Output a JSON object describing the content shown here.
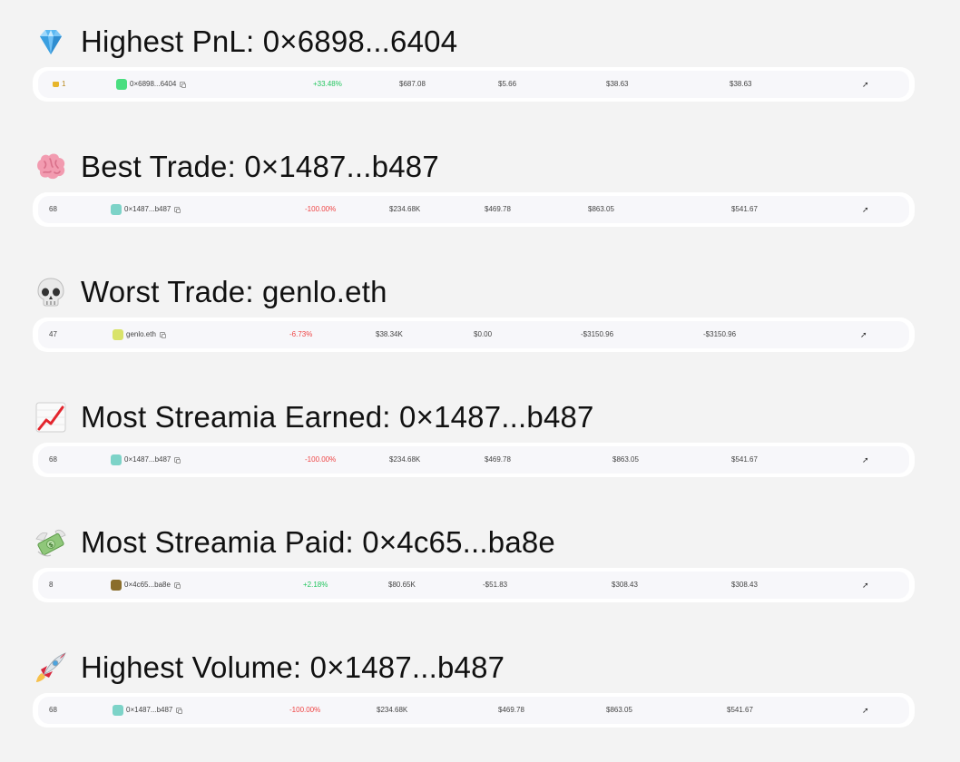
{
  "sections": [
    {
      "title": "Highest PnL: 0×6898...6404",
      "icon": "gem-icon",
      "row": {
        "rank": "1",
        "rank_has_crown": true,
        "trader": "0×6898...6404",
        "avatar_color": "#4ade80",
        "pnl_pct": "+33.48%",
        "pnl_sign": "pos",
        "col3": "$687.08",
        "col4": "$5.66",
        "col5": "$38.63",
        "col6": "$38.63"
      }
    },
    {
      "title": "Best Trade: 0×1487...b487",
      "icon": "brain-icon",
      "row": {
        "rank": "68",
        "rank_has_crown": false,
        "trader": "0×1487...b487",
        "avatar_color": "#7dd3c8",
        "pnl_pct": "-100.00%",
        "pnl_sign": "neg",
        "col3": "$234.68K",
        "col4": "$469.78",
        "col5": "$863.05",
        "col6": "$541.67"
      }
    },
    {
      "title": "Worst Trade: genlo.eth",
      "icon": "skull-icon",
      "row": {
        "rank": "47",
        "rank_has_crown": false,
        "trader": "genlo.eth",
        "avatar_color": "#d9e36a",
        "pnl_pct": "-6.73%",
        "pnl_sign": "neg",
        "col3": "$38.34K",
        "col4": "$0.00",
        "col5": "-$3150.96",
        "col6": "-$3150.96"
      }
    },
    {
      "title": "Most Streamia Earned: 0×1487...b487",
      "icon": "chart-increasing-icon",
      "row": {
        "rank": "68",
        "rank_has_crown": false,
        "trader": "0×1487...b487",
        "avatar_color": "#7dd3c8",
        "pnl_pct": "-100.00%",
        "pnl_sign": "neg",
        "col3": "$234.68K",
        "col4": "$469.78",
        "col5": "$863.05",
        "col6": "$541.67"
      }
    },
    {
      "title": "Most Streamia Paid: 0×4c65...ba8e",
      "icon": "money-with-wings-icon",
      "row": {
        "rank": "8",
        "rank_has_crown": false,
        "trader": "0×4c65...ba8e",
        "avatar_color": "#8a6d2b",
        "pnl_pct": "+2.18%",
        "pnl_sign": "pos",
        "col3": "$80.65K",
        "col4": "-$51.83",
        "col5": "$308.43",
        "col6": "$308.43"
      }
    },
    {
      "title": "Highest Volume: 0×1487...b487",
      "icon": "rocket-icon",
      "row": {
        "rank": "68",
        "rank_has_crown": false,
        "trader": "0×1487...b487",
        "avatar_color": "#7dd3c8",
        "pnl_pct": "-100.00%",
        "pnl_sign": "neg",
        "col3": "$234.68K",
        "col4": "$469.78",
        "col5": "$863.05",
        "col6": "$541.67"
      }
    }
  ],
  "share_glyph": "➚"
}
